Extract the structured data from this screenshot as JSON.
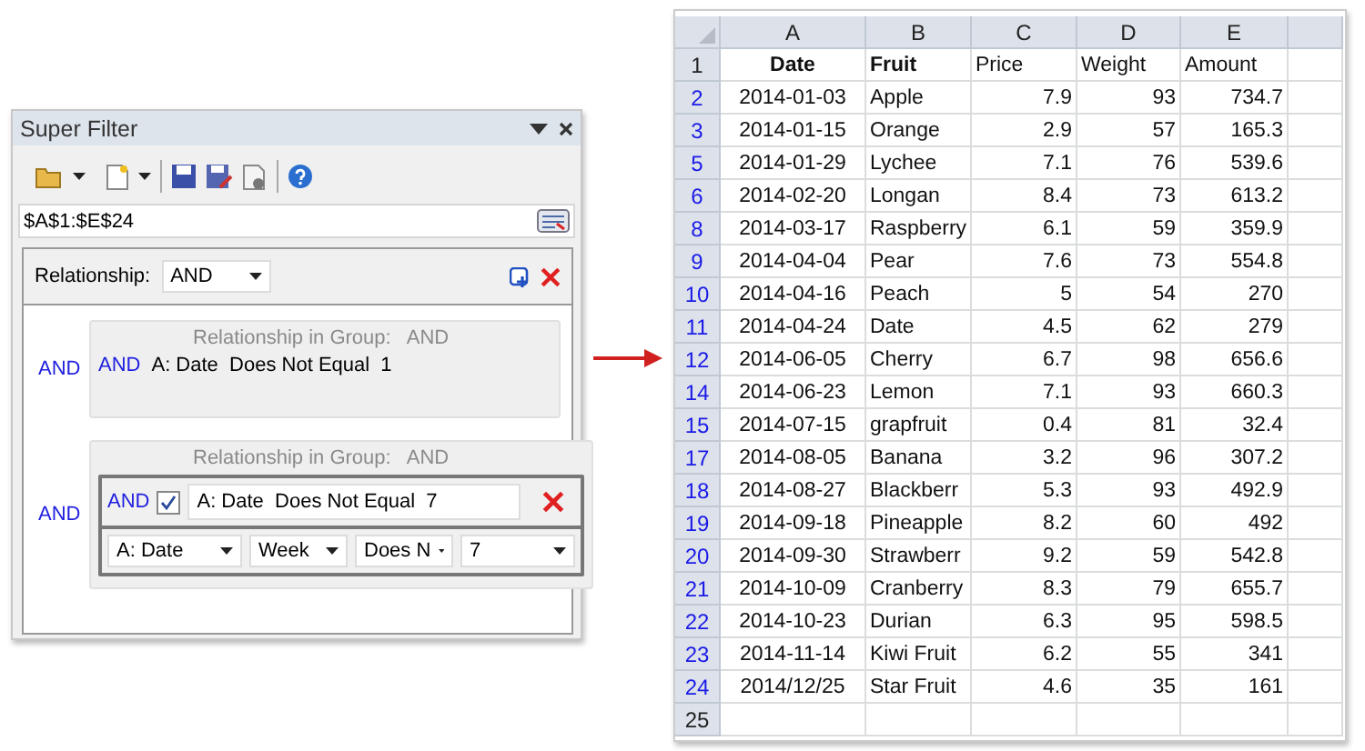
{
  "panel": {
    "title": "Super Filter",
    "range": "$A$1:$E$24",
    "relationship": {
      "label": "Relationship:",
      "value": "AND"
    },
    "groups": [
      {
        "outer_relation": "AND",
        "label": "Relationship in Group:",
        "relation": "AND",
        "conditions": [
          {
            "kind": "summary",
            "relation": "AND",
            "text": "A: Date  Does Not Equal  1"
          }
        ]
      },
      {
        "outer_relation": "AND",
        "label": "Relationship in Group:",
        "relation": "AND",
        "conditions": [
          {
            "kind": "editor",
            "relation": "AND",
            "checked": true,
            "text": "A: Date  Does Not Equal  7",
            "selects": [
              "A: Date",
              "Week",
              "Does N",
              "7"
            ]
          }
        ]
      }
    ]
  },
  "sheet": {
    "columns": [
      "A",
      "B",
      "C",
      "D",
      "E"
    ],
    "rows": [
      {
        "number": "1",
        "filtered": false,
        "cells": [
          {
            "text": "Date",
            "bold": true
          },
          {
            "text": "Fruit",
            "bold": true
          },
          {
            "text": "Price",
            "bold": false
          },
          {
            "text": "Weight",
            "bold": false
          },
          {
            "text": "Amount",
            "bold": false
          }
        ]
      },
      {
        "number": "2",
        "filtered": true,
        "cells": [
          "2014-01-03",
          "Apple",
          "7.9",
          "93",
          "734.7"
        ]
      },
      {
        "number": "3",
        "filtered": true,
        "cells": [
          "2014-01-15",
          "Orange",
          "2.9",
          "57",
          "165.3"
        ]
      },
      {
        "number": "5",
        "filtered": true,
        "cells": [
          "2014-01-29",
          "Lychee",
          "7.1",
          "76",
          "539.6"
        ]
      },
      {
        "number": "6",
        "filtered": true,
        "cells": [
          "2014-02-20",
          "Longan",
          "8.4",
          "73",
          "613.2"
        ]
      },
      {
        "number": "8",
        "filtered": true,
        "cells": [
          "2014-03-17",
          "Raspberry",
          "6.1",
          "59",
          "359.9"
        ]
      },
      {
        "number": "9",
        "filtered": true,
        "cells": [
          "2014-04-04",
          "Pear",
          "7.6",
          "73",
          "554.8"
        ]
      },
      {
        "number": "10",
        "filtered": true,
        "cells": [
          "2014-04-16",
          "Peach",
          "5",
          "54",
          "270"
        ]
      },
      {
        "number": "11",
        "filtered": true,
        "cells": [
          "2014-04-24",
          "Date",
          "4.5",
          "62",
          "279"
        ]
      },
      {
        "number": "12",
        "filtered": true,
        "cells": [
          "2014-06-05",
          "Cherry",
          "6.7",
          "98",
          "656.6"
        ]
      },
      {
        "number": "14",
        "filtered": true,
        "cells": [
          "2014-06-23",
          "Lemon",
          "7.1",
          "93",
          "660.3"
        ]
      },
      {
        "number": "15",
        "filtered": true,
        "cells": [
          "2014-07-15",
          "grapfruit",
          "0.4",
          "81",
          "32.4"
        ]
      },
      {
        "number": "17",
        "filtered": true,
        "cells": [
          "2014-08-05",
          "Banana",
          "3.2",
          "96",
          "307.2"
        ]
      },
      {
        "number": "18",
        "filtered": true,
        "cells": [
          "2014-08-27",
          "Blackberr",
          "5.3",
          "93",
          "492.9"
        ]
      },
      {
        "number": "19",
        "filtered": true,
        "cells": [
          "2014-09-18",
          "Pineapple",
          "8.2",
          "60",
          "492"
        ]
      },
      {
        "number": "20",
        "filtered": true,
        "cells": [
          "2014-09-30",
          "Strawberr",
          "9.2",
          "59",
          "542.8"
        ]
      },
      {
        "number": "21",
        "filtered": true,
        "cells": [
          "2014-10-09",
          "Cranberry",
          "8.3",
          "79",
          "655.7"
        ]
      },
      {
        "number": "22",
        "filtered": true,
        "cells": [
          "2014-10-23",
          "Durian",
          "6.3",
          "95",
          "598.5"
        ]
      },
      {
        "number": "23",
        "filtered": true,
        "cells": [
          "2014-11-14",
          "Kiwi Fruit",
          "6.2",
          "55",
          "341"
        ]
      },
      {
        "number": "24",
        "filtered": true,
        "cells": [
          "2014/12/25",
          "Star Fruit",
          "4.6",
          "35",
          "161"
        ]
      },
      {
        "number": "25",
        "filtered": false,
        "cells": []
      }
    ]
  }
}
